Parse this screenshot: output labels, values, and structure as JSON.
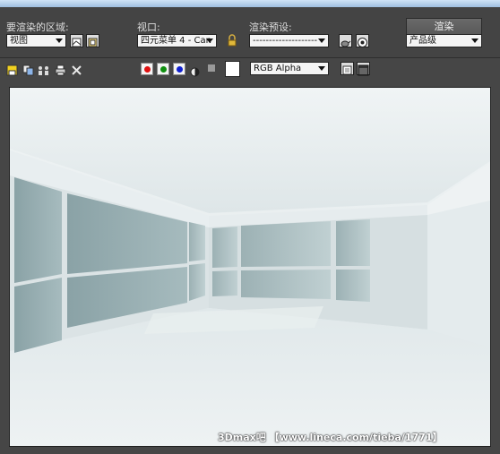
{
  "toolbar": {
    "area_label": "要渲染的区域:",
    "area_value": "视图",
    "viewport_label": "视口:",
    "viewport_value": "四元菜单 4 - Can",
    "preset_label": "渲染预设:",
    "preset_value": "--------------------",
    "render_button": "渲染",
    "quality_value": "产品级"
  },
  "frame_toolbar": {
    "channel_value": "RGB Alpha"
  },
  "render": {
    "watermark": "3Dmax吧 【www.lineca.com/tieba/1771】"
  },
  "colors": {
    "red": "#e01010",
    "green": "#109010",
    "blue": "#1020d0"
  }
}
